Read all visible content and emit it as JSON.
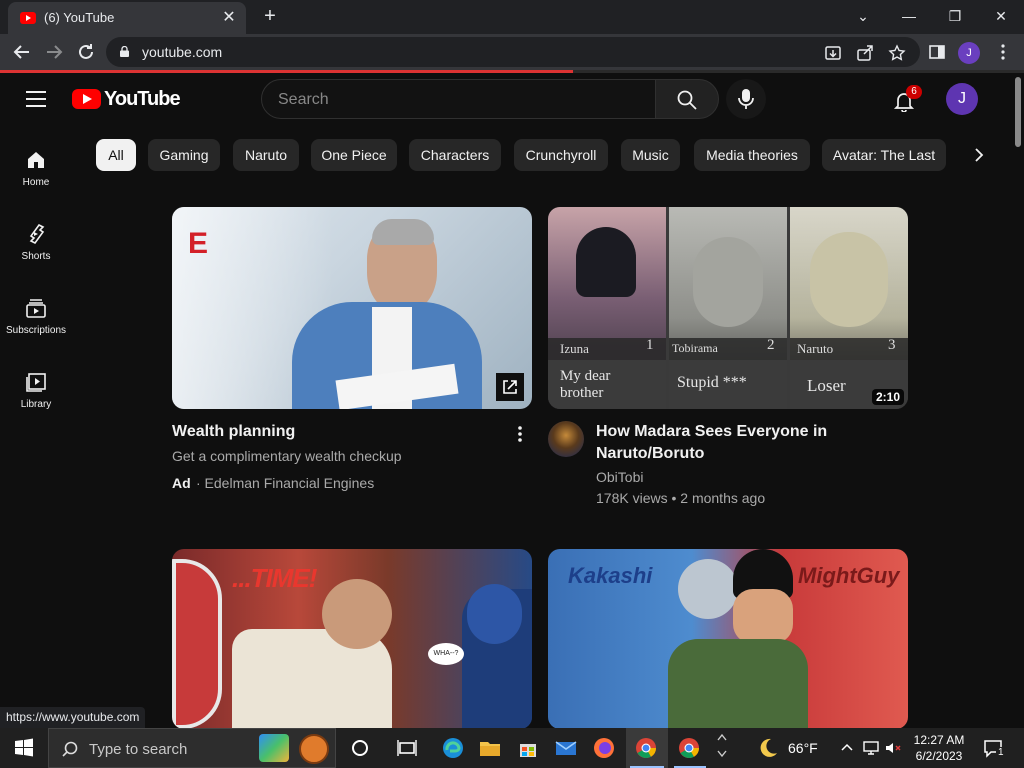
{
  "browser": {
    "tab_title": "(6) YouTube",
    "tab_close": "✕",
    "new_tab": "+",
    "url": "youtube.com",
    "profile_initial": "J",
    "window_controls": {
      "minimize": "—",
      "restore": "❐",
      "close": "✕",
      "tab_search": "⌄"
    },
    "load_progress": 0.56,
    "status_url": "https://www.youtube.com"
  },
  "header": {
    "logo_text": "YouTube",
    "search_placeholder": "Search",
    "notification_count": "6",
    "avatar_initial": "J"
  },
  "guide": [
    {
      "label": "Home",
      "icon": "home-icon"
    },
    {
      "label": "Shorts",
      "icon": "shorts-icon"
    },
    {
      "label": "Subscriptions",
      "icon": "subscriptions-icon"
    },
    {
      "label": "Library",
      "icon": "library-icon"
    }
  ],
  "chips": [
    "All",
    "Gaming",
    "Naruto",
    "One Piece",
    "Characters",
    "Crunchyroll",
    "Music",
    "Media theories",
    "Avatar: The Last"
  ],
  "videos": [
    {
      "title": "Wealth planning",
      "subtitle": "Get a complimentary wealth checkup",
      "ad_label": "Ad",
      "advertiser": "· Edelman Financial Engines",
      "logo_letter": "E"
    },
    {
      "title_line1": "How Madara Sees Everyone in",
      "title_line2": "Naruto/Boruto",
      "channel": "ObiTobi",
      "meta": "178K views • 2 months ago",
      "duration": "2:10",
      "panels": [
        {
          "name": "Izuna",
          "num": "1",
          "caption": "My dear brother"
        },
        {
          "name": "Tobirama",
          "num": "2",
          "caption": "Stupid ***"
        },
        {
          "name": "Naruto",
          "num": "3",
          "caption": "Loser"
        }
      ]
    },
    {
      "overlay": "...TIME!",
      "bubble": "WHA--?"
    },
    {
      "overlay_left": "Kakashi",
      "overlay_right": "MightGuy"
    }
  ],
  "taskbar": {
    "search_placeholder": "Type to search",
    "weather": "66°F",
    "time": "12:27 AM",
    "date": "6/2/2023",
    "notif_count": "1"
  },
  "colors": {
    "yt_red": "#ff0000",
    "accent_purple": "#5e35b1",
    "bg": "#0f0f0f"
  }
}
